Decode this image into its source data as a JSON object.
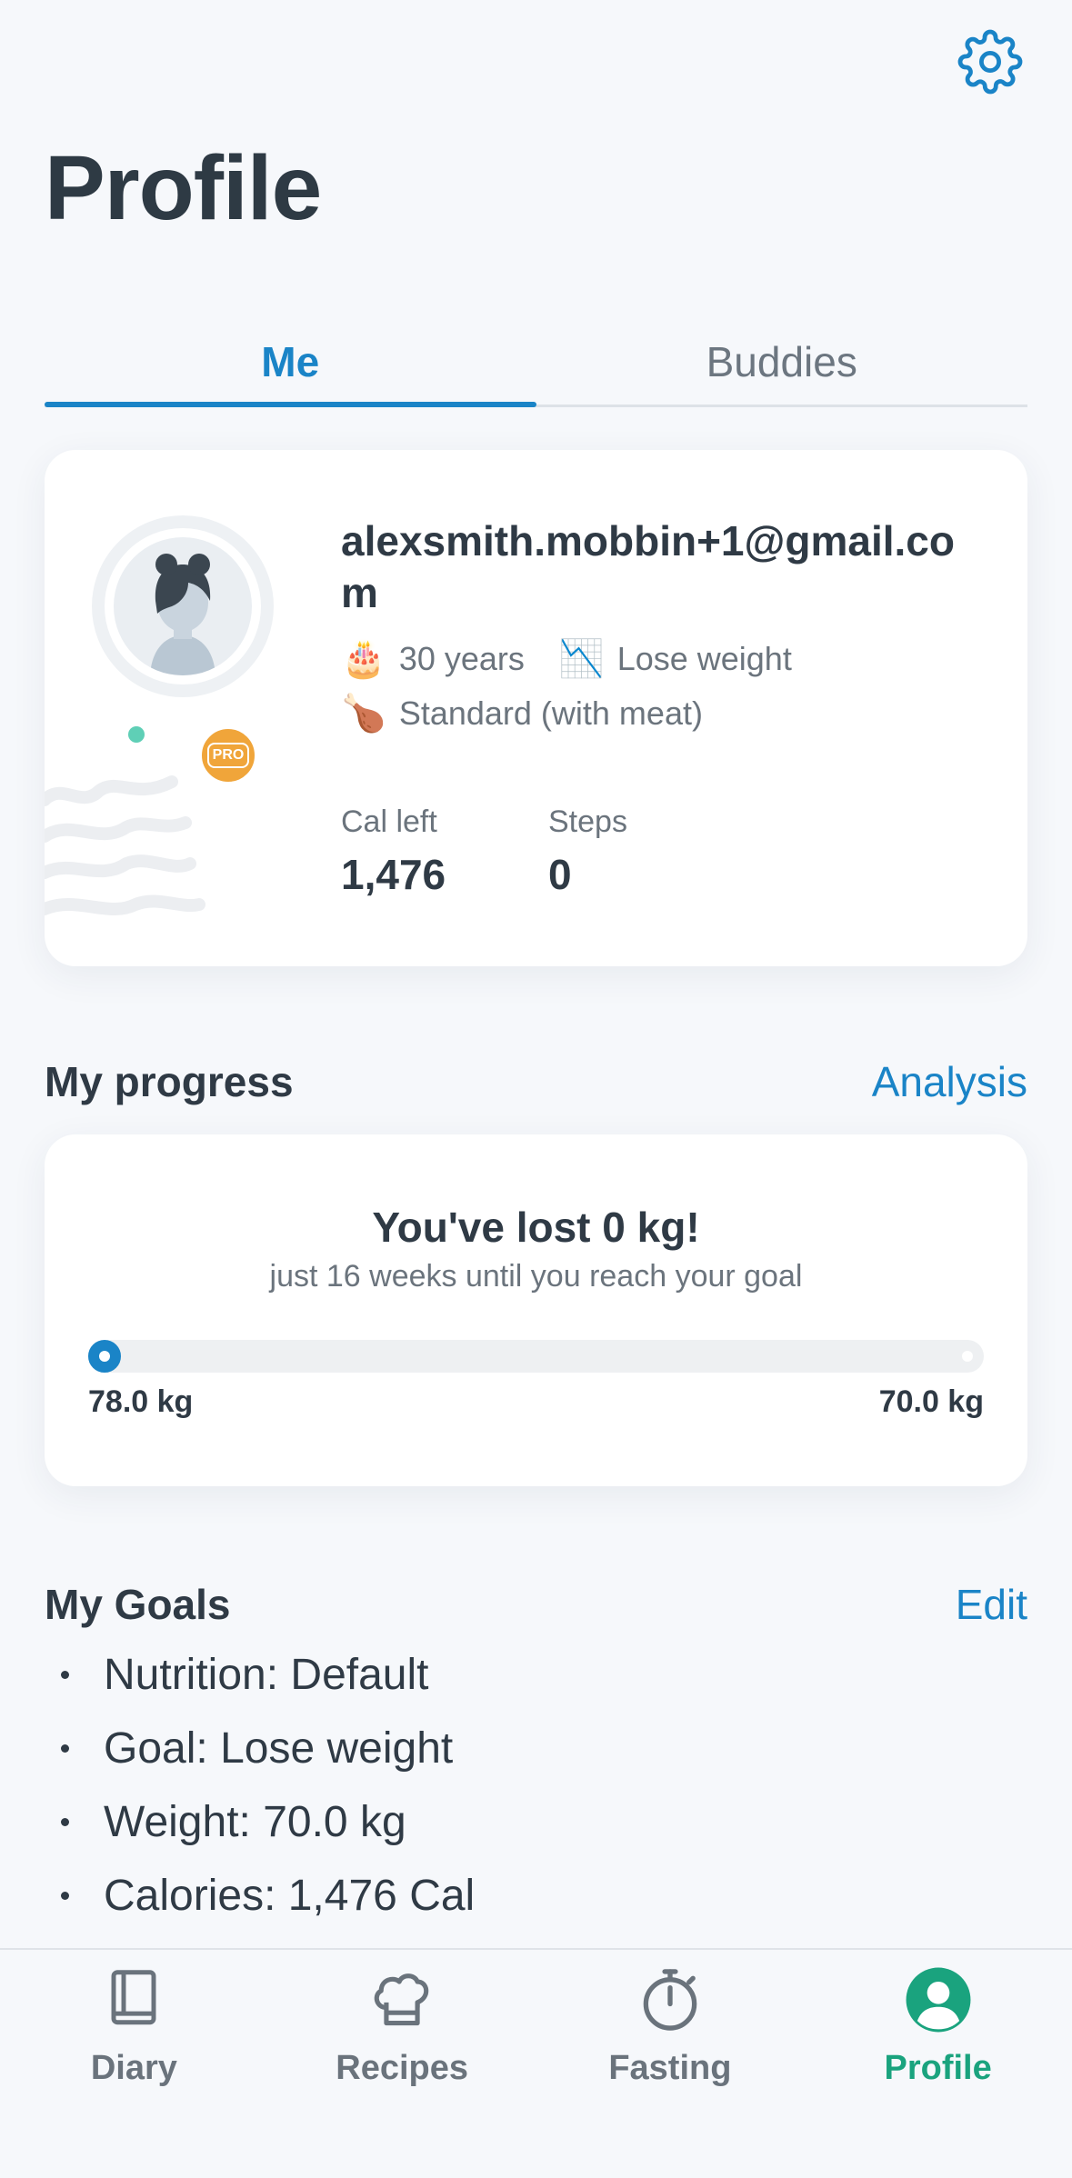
{
  "header": {
    "title": "Profile",
    "settings_icon": "gear-icon"
  },
  "tabs": [
    {
      "label": "Me",
      "active": true
    },
    {
      "label": "Buddies",
      "active": false
    }
  ],
  "profile": {
    "email": "alexsmith.mobbin+1@gmail.com",
    "age_icon": "🎂",
    "age": "30 years",
    "goal_icon": "📉",
    "goal": "Lose weight",
    "diet_icon": "🍗",
    "diet": "Standard (with meat)",
    "badge": "PRO",
    "stats": [
      {
        "label": "Cal left",
        "value": "1,476"
      },
      {
        "label": "Steps",
        "value": "0"
      }
    ]
  },
  "progress": {
    "title": "My progress",
    "link": "Analysis",
    "headline": "You've lost 0 kg!",
    "subline": "just 16 weeks until you reach your goal",
    "start_label": "78.0 kg",
    "end_label": "70.0 kg",
    "fraction": 0.0
  },
  "goals": {
    "title": "My Goals",
    "link": "Edit",
    "items": [
      "Nutrition: Default",
      "Goal: Lose weight",
      "Weight: 70.0 kg",
      "Calories: 1,476 Cal"
    ]
  },
  "nav": [
    {
      "label": "Diary",
      "icon": "book-icon",
      "active": false
    },
    {
      "label": "Recipes",
      "icon": "chef-hat-icon",
      "active": false
    },
    {
      "label": "Fasting",
      "icon": "stopwatch-icon",
      "active": false
    },
    {
      "label": "Profile",
      "icon": "user-icon",
      "active": true
    }
  ],
  "colors": {
    "accent": "#1a84c7",
    "active_nav": "#1aa37e",
    "pro_badge": "#f0a53a"
  }
}
